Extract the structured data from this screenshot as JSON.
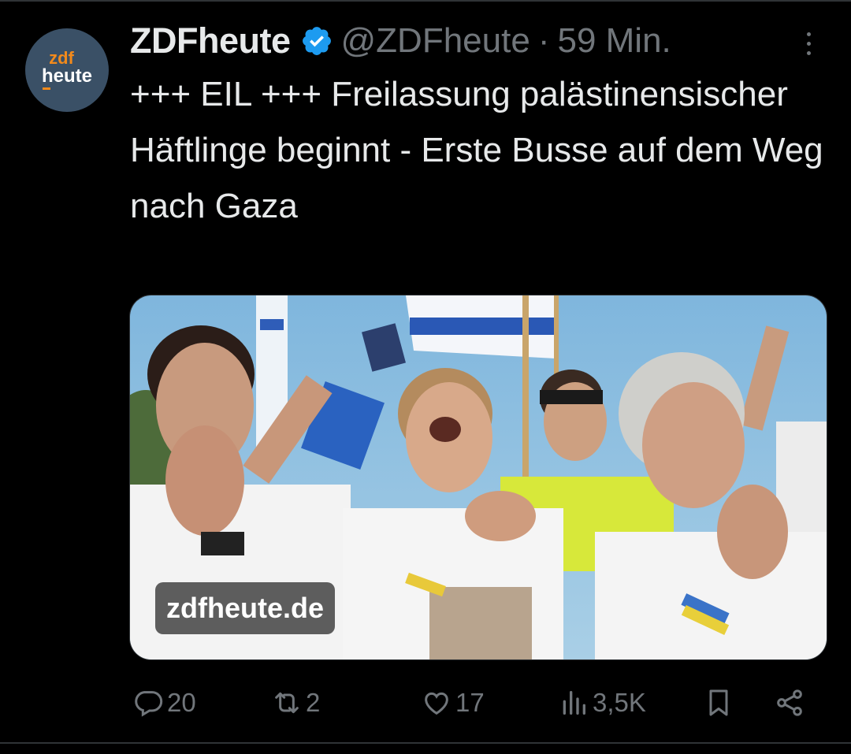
{
  "tweet": {
    "display_name": "ZDFheute",
    "handle": "@ZDFheute",
    "separator": "·",
    "time": "59 Min.",
    "text": "+++ EIL +++ Freilassung palästinensischer Häftlinge beginnt - Erste Busse auf dem Weg nach Gaza",
    "verified": true,
    "avatar": {
      "line1": "zdf",
      "line2": "heute"
    },
    "media": {
      "source_badge": "zdfheute.de"
    }
  },
  "actions": {
    "replies": "20",
    "reposts": "2",
    "likes": "17",
    "views": "3,5K"
  },
  "icons": {
    "verified": "verified-badge-icon",
    "more": "more-icon",
    "reply": "reply-icon",
    "repost": "repost-icon",
    "like": "heart-icon",
    "views": "views-icon",
    "bookmark": "bookmark-icon",
    "share": "share-icon"
  },
  "colors": {
    "background": "#000000",
    "text": "#e7e9ea",
    "muted": "#71767b",
    "verified": "#1d9bf0",
    "avatar_bg": "#3a5066",
    "avatar_accent": "#f28a1c"
  }
}
